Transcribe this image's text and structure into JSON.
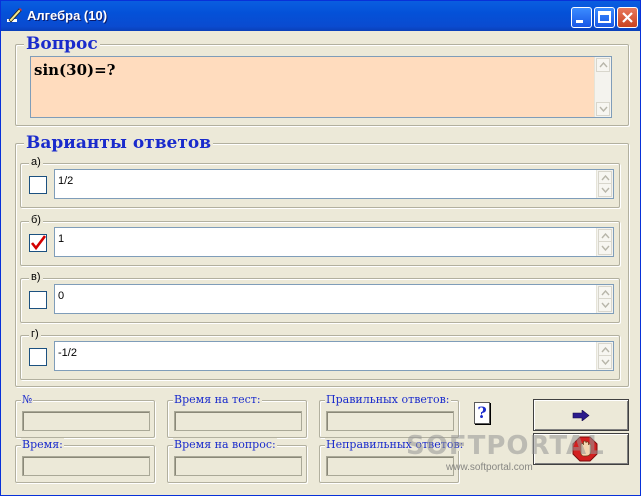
{
  "window": {
    "title": "Алгебра (10)"
  },
  "question": {
    "group_title": "Вопрос",
    "text": "sin(30)=?"
  },
  "answers": {
    "group_title": "Варианты ответов",
    "items": [
      {
        "letter": "а)",
        "value": "1/2",
        "checked": false
      },
      {
        "letter": "б)",
        "value": "1",
        "checked": true
      },
      {
        "letter": "в)",
        "value": "0",
        "checked": false
      },
      {
        "letter": "г)",
        "value": "-1/2",
        "checked": false
      }
    ]
  },
  "stats": {
    "number_label": "№",
    "test_time_label": "Время на тест:",
    "correct_label": "Правильных ответов:",
    "time_label": "Время:",
    "question_time_label": "Время на вопрос:",
    "incorrect_label": "Неправильных ответов:",
    "number_value": "",
    "test_time_value": "",
    "correct_value": "",
    "time_value": "",
    "question_time_value": "",
    "incorrect_value": ""
  },
  "buttons": {
    "help_label": "?"
  },
  "icons": {
    "app": "pencil-icon",
    "next": "arrow-right-icon",
    "stop": "stop-hand-icon",
    "check": "checkmark-icon"
  },
  "colors": {
    "title_accent": "#1a2bcc",
    "question_bg": "#ffdcbe",
    "check_mark": "#d40000",
    "stop_red": "#d31f1f"
  },
  "watermark": {
    "logo": "SOFTPORTAL",
    "url": "www.softportal.com"
  }
}
